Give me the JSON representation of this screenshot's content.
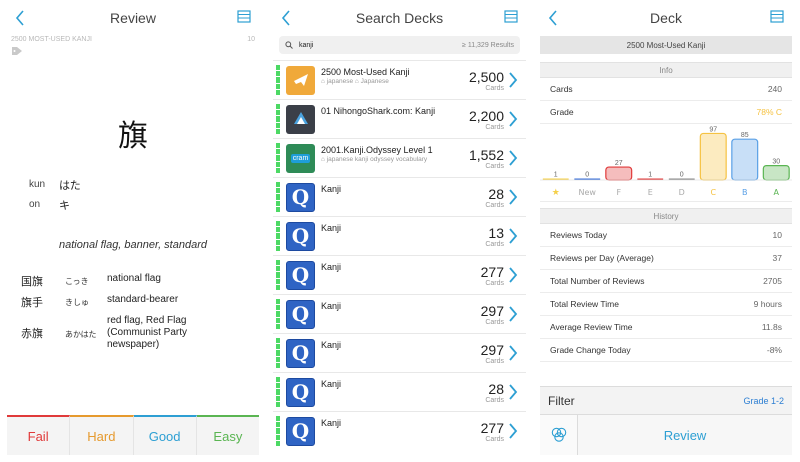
{
  "colors": {
    "accent": "#2d9fd3",
    "fail": "#e03a3a",
    "hard": "#e69a2e",
    "good": "#2d9fd3",
    "easy": "#5ab552",
    "stripe": "#4cd964",
    "grade_c": "#f5c242"
  },
  "review": {
    "title": "Review",
    "deck_label": "2500 MOST-USED KANJI",
    "count": "10",
    "kanji": "旗",
    "readings": [
      {
        "label": "kun",
        "value": "はた"
      },
      {
        "label": "on",
        "value": "キ"
      }
    ],
    "meaning": "national flag, banner, standard",
    "examples": [
      {
        "word": "国旗",
        "furigana": "こっき",
        "meaning": "national flag"
      },
      {
        "word": "旗手",
        "furigana": "きしゅ",
        "meaning": "standard-bearer"
      },
      {
        "word": "赤旗",
        "furigana": "あかはた",
        "meaning": "red flag, Red Flag (Communist Party newspaper)"
      }
    ],
    "answers": {
      "fail": "Fail",
      "hard": "Hard",
      "good": "Good",
      "easy": "Easy"
    }
  },
  "search": {
    "title": "Search Decks",
    "query": "kanji",
    "results": "≥ 11,329 Results",
    "decks": [
      {
        "name": "2500 Most-Used Kanji",
        "tags": "⌂ japanese  ⌂ Japanese",
        "count": "2,500",
        "unit": "Cards",
        "thumb": "plane"
      },
      {
        "name": "01 NihongoShark.com: Kanji",
        "tags": "",
        "count": "2,200",
        "unit": "Cards",
        "thumb": "shark"
      },
      {
        "name": "2001.Kanji.Odyssey Level 1",
        "tags": "⌂ japanese kanji odyssey vocabulary",
        "count": "1,552",
        "unit": "Cards",
        "thumb": "cram"
      },
      {
        "name": "Kanji",
        "tags": "",
        "count": "28",
        "unit": "Cards",
        "thumb": "Q"
      },
      {
        "name": "Kanji",
        "tags": "",
        "count": "13",
        "unit": "Cards",
        "thumb": "Q"
      },
      {
        "name": "Kanji",
        "tags": "",
        "count": "277",
        "unit": "Cards",
        "thumb": "Q"
      },
      {
        "name": "Kanji",
        "tags": "",
        "count": "297",
        "unit": "Cards",
        "thumb": "Q"
      },
      {
        "name": "Kanji",
        "tags": "",
        "count": "297",
        "unit": "Cards",
        "thumb": "Q"
      },
      {
        "name": "Kanji",
        "tags": "",
        "count": "28",
        "unit": "Cards",
        "thumb": "Q"
      },
      {
        "name": "Kanji",
        "tags": "",
        "count": "277",
        "unit": "Cards",
        "thumb": "Q"
      }
    ],
    "cram_label": "cram"
  },
  "deck": {
    "title": "Deck",
    "name": "2500 Most-Used Kanji",
    "info_label": "Info",
    "cards_label": "Cards",
    "cards_value": "240",
    "grade_label": "Grade",
    "grade_value": "78% C",
    "history_label": "History",
    "history": [
      {
        "label": "Reviews Today",
        "value": "10"
      },
      {
        "label": "Reviews per Day (Average)",
        "value": "37"
      },
      {
        "label": "Total Number of Reviews",
        "value": "2705"
      },
      {
        "label": "Total Review Time",
        "value": "9 hours"
      },
      {
        "label": "Average Review Time",
        "value": "11.8s"
      },
      {
        "label": "Grade Change Today",
        "value": "-8%"
      }
    ],
    "filter_label": "Filter",
    "filter_value": "Grade 1-2",
    "review_button": "Review"
  },
  "chart_data": {
    "type": "bar",
    "categories": [
      "★",
      "New",
      "F",
      "E",
      "D",
      "C",
      "B",
      "A"
    ],
    "values": [
      1,
      0,
      27,
      1,
      0,
      97,
      85,
      30
    ],
    "colors": [
      "#f5d04a",
      "#3a6fd8",
      "#e03a3a",
      "#e03a3a",
      "#888888",
      "#f5c242",
      "#5aa0e6",
      "#5ab552"
    ],
    "ylim": [
      0,
      100
    ]
  }
}
